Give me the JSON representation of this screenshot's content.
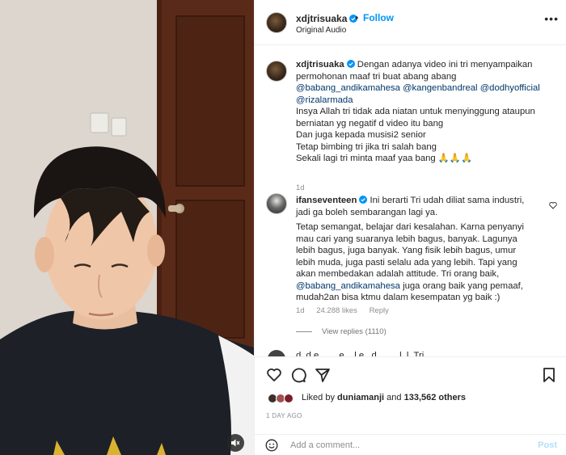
{
  "header": {
    "username": "xdjtrisuaka",
    "separator": "•",
    "follow_label": "Follow",
    "audio_label": "Original Audio",
    "more_label": "•••"
  },
  "caption": {
    "username": "xdjtrisuaka",
    "lines": [
      "Dengan adanya video ini tri menyampaikan",
      "permohonan maaf tri buat abang abang",
      "Insya Allah tri tidak ada niatan untuk menyinggung ataupun",
      "berniatan yg negatif d video itu bang",
      "Dan juga kepada musisi2 senior",
      "Tetap bimbing tri jika tri salah bang",
      "Sekali lagi tri minta maaf yaa bang 🙏🙏🙏"
    ],
    "mentions_line1": "@babang_andikamahesa @kangenbandreal @dodhyofficial",
    "mentions_line2": "@rizalarmada",
    "age": "1d"
  },
  "comment": {
    "username": "ifanseventeen",
    "lines": [
      "Ini berarti Tri udah diliat sama industri,",
      "jadi ga boleh sembarangan lagi ya.",
      "Tetap semangat, belajar dari kesalahan. Karna penyanyi",
      "mau cari yang suaranya lebih bagus, banyak. Lagunya",
      "lebih bagus, juga banyak. Yang fisik lebih bagus, umur",
      "lebih muda, juga pasti selalu ada yang lebih. Tapi yang",
      "akan membedakan adalah attitude. Tri orang baik,",
      "juga orang baik yang pemaaf,",
      "mudah2an bisa ktmu dalam kesempatan yg baik :)"
    ],
    "mention": "@babang_andikamahesa",
    "age": "1d",
    "likes": "24.288 likes",
    "reply_label": "Reply",
    "view_replies": "View replies (1110)"
  },
  "partial_comment": {
    "text": "d..d.e..... ..e ...l.e ..d.. ... ..l..l. Tri ...."
  },
  "actions": {
    "icons": [
      "heart-icon",
      "comment-icon",
      "share-icon",
      "bookmark-icon"
    ],
    "liked_by_prefix": "Liked by",
    "liked_by_user": "duniamanji",
    "liked_by_and": "and",
    "liked_by_count": "133,562 others",
    "time": "1 DAY AGO"
  },
  "add_comment": {
    "placeholder": "Add a comment...",
    "post_label": "Post"
  },
  "colors": {
    "accent": "#0095f6",
    "mention": "#00376b",
    "muted": "#8e8e8e",
    "post_disabled": "#b2dffc"
  }
}
